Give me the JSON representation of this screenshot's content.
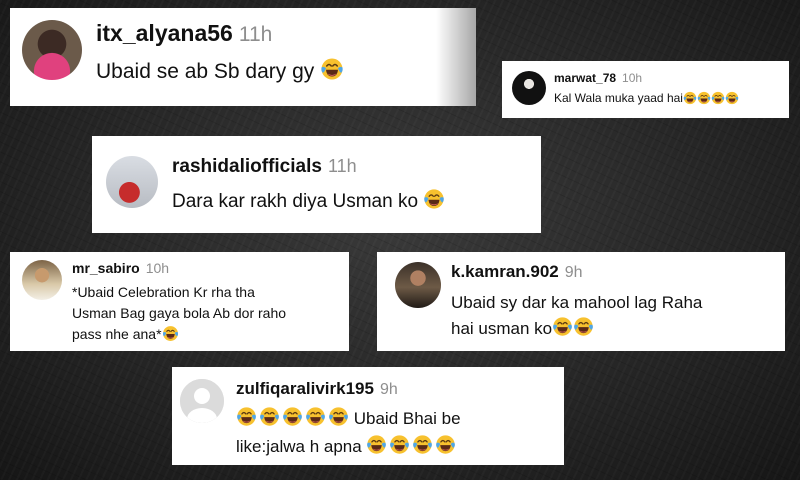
{
  "comments": [
    {
      "username": "itx_alyana56",
      "time": "11h",
      "text": "Ubaid se ab Sb dary gy",
      "emoji_count": 1
    },
    {
      "username": "marwat_78",
      "time": "10h",
      "text": "Kal Wala muka yaad hai",
      "emoji_count": 4
    },
    {
      "username": "rashidaliofficials",
      "time": "11h",
      "text": "Dara kar rakh diya Usman ko",
      "emoji_count": 1
    },
    {
      "username": "mr_sabiro",
      "time": "10h",
      "text": "*Ubaid Celebration Kr rha tha\nUsman Bag gaya bola Ab dor raho\npass nhe ana*",
      "emoji_count": 1
    },
    {
      "username": "k.kamran.902",
      "time": "9h",
      "text": "Ubaid sy dar ka mahool lag Raha\nhai usman ko",
      "emoji_count": 2
    },
    {
      "username": "zulfiqaralivirk195",
      "time": "9h",
      "emoji_prefix_count": 5,
      "text": "Ubaid Bhai be\nlike:jalwa h apna",
      "emoji_count": 4
    }
  ],
  "emoji": "laughing-crying-emoji",
  "colors": {
    "card": "#ffffff",
    "username": "#111111",
    "time": "#8e8e8e",
    "emoji_face": "#f7c12e",
    "tears": "#4fa6e6"
  }
}
